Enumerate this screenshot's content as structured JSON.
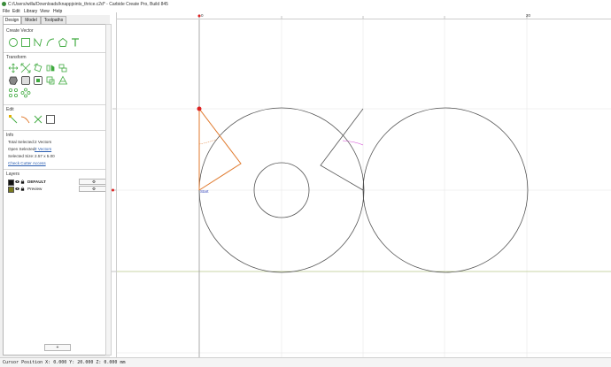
{
  "window": {
    "title": "C:/Users/willa/Downloads/knappjoints_thrice.c2d* - Carbide Create Pro, Build 845"
  },
  "menu": [
    "File",
    "Edit",
    "Library",
    "View",
    "Help"
  ],
  "tabs": [
    {
      "label": "Design",
      "active": true
    },
    {
      "label": "Model",
      "active": false
    },
    {
      "label": "Toolpaths",
      "active": false
    }
  ],
  "panel": {
    "create_vector": {
      "title": "Create Vector",
      "tools": [
        "circle-icon",
        "rectangle-icon",
        "polyline-icon",
        "arc-icon",
        "polygon-icon",
        "text-icon"
      ]
    },
    "transform": {
      "title": "Transform",
      "tools": [
        "move-icon",
        "scale-icon",
        "rotate-icon",
        "mirror-icon",
        "align-icon",
        "offset-icon",
        "boolean-union-icon",
        "boolean-subtract-icon",
        "boolean-intersect-icon",
        "array-icon",
        "circular-array-icon",
        "join-icon"
      ]
    },
    "edit": {
      "title": "Edit",
      "tools": [
        "node-edit-icon",
        "trim-icon",
        "cut-icon",
        "bounding-box-icon"
      ]
    },
    "info": {
      "title": "Info",
      "total_selected_label": "Total Selected:",
      "total_selected_value": "2 Vectors",
      "open_selected_label": "Open Selected:",
      "open_selected_value": "2 Vectors",
      "selected_size_label": "Selected Size:",
      "selected_size_value": "2.57 x 5.00",
      "check_access_label": "Check Cutter Access"
    },
    "layers": {
      "title": "Layers",
      "items": [
        {
          "name": "DEFAULT",
          "color": "#111111"
        },
        {
          "name": "Preview",
          "color": "#7a7a1e"
        }
      ],
      "gear_label": "⚙",
      "add_label": "+"
    }
  },
  "ruler": {
    "labels": [
      "0",
      "20"
    ]
  },
  "canvas": {
    "start_label": "Start",
    "colors": {
      "geometry": "#555555",
      "selected": "#e07a2e",
      "grid": "#e6e6e6",
      "axis_x": "#b9c98a",
      "selection_marker": "#dd2222",
      "hint_arc": "#d23bd2"
    }
  },
  "status": {
    "text": "Cursor Position X: 0.000 Y: 20.000 Z: 0.000 mm"
  }
}
